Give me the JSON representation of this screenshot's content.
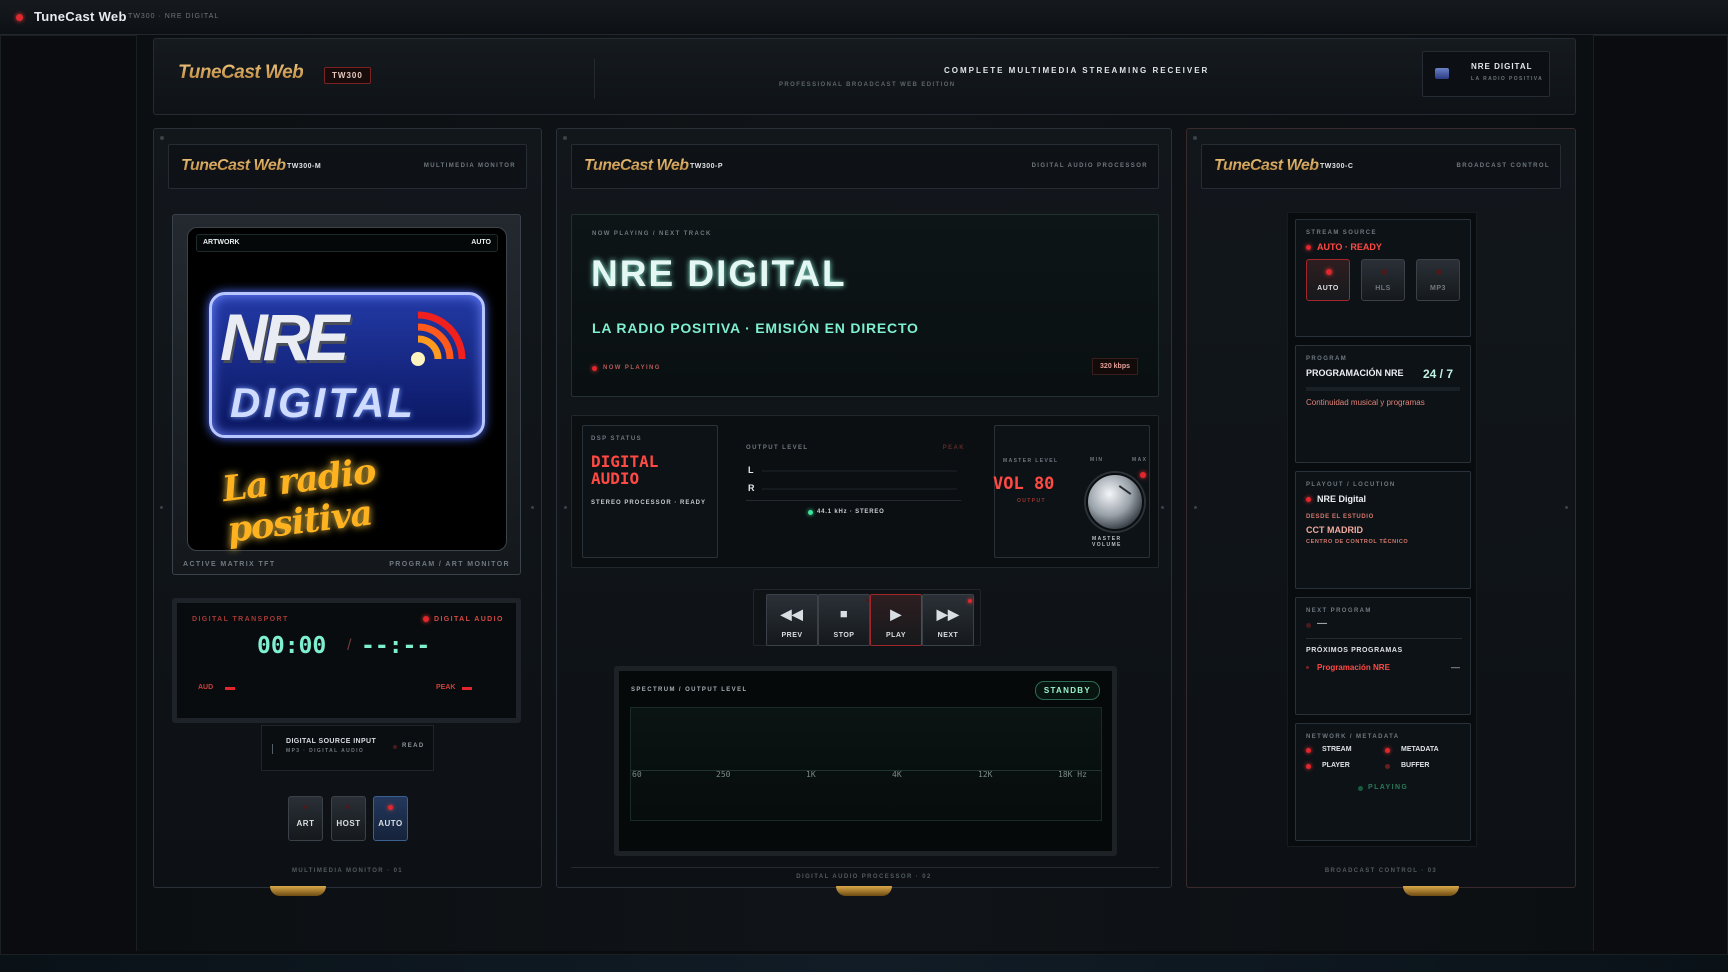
{
  "app": {
    "title": "TuneCast Web",
    "subtitle": "TW300 · NRE DIGITAL"
  },
  "header": {
    "brand": "TuneCast Web",
    "model": "TW300",
    "headline": "COMPLETE MULTIMEDIA STREAMING RECEIVER",
    "edition": "PROFESSIONAL BROADCAST WEB EDITION",
    "station_name": "NRE DIGITAL",
    "station_tagline": "LA RADIO POSITIVA"
  },
  "monitor": {
    "brand": "TuneCast Web",
    "model": "TW300-M",
    "label": "MULTIMEDIA MONITOR",
    "artwork_label": "ARTWORK",
    "artwork_mode": "AUTO",
    "art_logo_top": "NRE",
    "art_logo_bottom": "DIGITAL",
    "art_script": "La radio positiva",
    "screen_left": "ACTIVE MATRIX TFT",
    "screen_right": "PROGRAM / ART MONITOR",
    "transport_label": "DIGITAL TRANSPORT",
    "transport_status": "DIGITAL AUDIO",
    "time_current": "00:00",
    "time_sep": "/",
    "time_total": "--:--",
    "aud_label": "AUD",
    "peak_label": "PEAK",
    "source_title": "DIGITAL SOURCE INPUT",
    "source_sub": "MP3 · DIGITAL AUDIO",
    "source_status": "READ",
    "buttons": [
      "ART",
      "HOST",
      "AUTO"
    ],
    "footer": "MULTIMEDIA MONITOR · 01"
  },
  "processor": {
    "brand": "TuneCast Web",
    "model": "TW300-P",
    "label": "DIGITAL AUDIO PROCESSOR",
    "np_label": "NOW PLAYING / NEXT TRACK",
    "np_title": "NRE DIGITAL",
    "np_subtitle": "LA RADIO POSITIVA · EMISIÓN EN DIRECTO",
    "np_status": "NOW PLAYING",
    "bitrate": "320 kbps",
    "dsp_label": "DSP STATUS",
    "dsp_value": "DIGITAL AUDIO",
    "dsp_sub": "STEREO PROCESSOR · READY",
    "output_label": "OUTPUT LEVEL",
    "peak_label": "PEAK",
    "ch_left": "L",
    "ch_right": "R",
    "format": "44.1 kHz · STEREO",
    "master_label": "MASTER LEVEL",
    "vol": "VOL 80",
    "vol_sub": "OUTPUT",
    "knob_min": "MIN",
    "knob_max": "MAX",
    "knob_label": "MASTER VOLUME",
    "transport": [
      {
        "icon": "prev-icon",
        "glyph": "◀◀",
        "label": "PREV"
      },
      {
        "icon": "stop-icon",
        "glyph": "■",
        "label": "STOP"
      },
      {
        "icon": "play-icon",
        "glyph": "▶",
        "label": "PLAY"
      },
      {
        "icon": "next-icon",
        "glyph": "▶▶",
        "label": "NEXT"
      }
    ],
    "spectrum_label": "SPECTRUM / OUTPUT LEVEL",
    "spectrum_status": "STANDBY",
    "freqs": [
      "60",
      "250",
      "1K",
      "4K",
      "12K",
      "18K Hz"
    ],
    "footer": "DIGITAL AUDIO PROCESSOR · 02"
  },
  "control": {
    "brand": "TuneCast Web",
    "model": "TW300-C",
    "label": "BROADCAST CONTROL",
    "source_label": "STREAM SOURCE",
    "source_status": "AUTO · READY",
    "source_buttons": [
      "AUTO",
      "HLS",
      "MP3"
    ],
    "program_label": "PROGRAM",
    "program_name": "PROGRAMACIÓN NRE",
    "program_hours": "24 / 7",
    "program_desc": "Continuidad musical y programas",
    "playout_label": "PLAYOUT / LOCUTION",
    "playout_name": "NRE Digital",
    "studio_label": "DESDE EL ESTUDIO",
    "studio_city": "CCT MADRID",
    "studio_sub": "CENTRO DE CONTROL TÉCNICO",
    "next_label": "NEXT PROGRAM",
    "next_value": "—",
    "upcoming_label": "PRÓXIMOS PROGRAMAS",
    "upcoming_item": "Programación NRE",
    "upcoming_time": "—",
    "network_label": "NETWORK / METADATA",
    "net_items": [
      "STREAM",
      "METADATA",
      "PLAYER",
      "BUFFER"
    ],
    "net_status": "PLAYING",
    "footer": "BROADCAST CONTROL · 03"
  },
  "colors": {
    "accent_red": "#e3262c",
    "accent_teal": "#7ef0cf",
    "gold": "#d7a45b"
  }
}
